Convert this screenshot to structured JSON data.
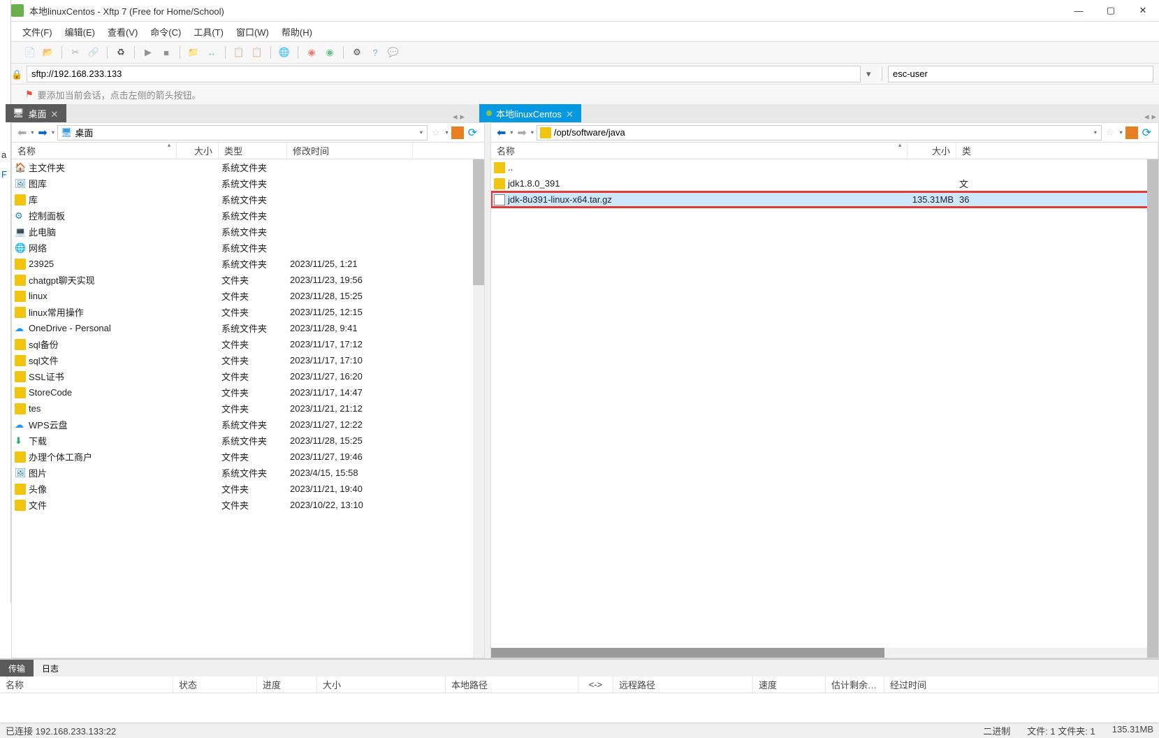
{
  "window": {
    "title": "本地linuxCentos - Xftp 7 (Free for Home/School)"
  },
  "menu": [
    "文件(F)",
    "编辑(E)",
    "查看(V)",
    "命令(C)",
    "工具(T)",
    "窗口(W)",
    "帮助(H)"
  ],
  "address": {
    "url": "sftp://192.168.233.133",
    "user": "esc-user"
  },
  "hint": "要添加当前会话，点击左侧的箭头按钮。",
  "tabs": {
    "local": "桌面",
    "remote": "本地linuxCentos"
  },
  "left_pane": {
    "path": "桌面",
    "cols": {
      "name": "名称",
      "size": "大小",
      "type": "类型",
      "modified": "修改时间"
    },
    "rows": [
      {
        "icon": "home",
        "name": "主文件夹",
        "type": "系统文件夹",
        "modified": ""
      },
      {
        "icon": "pic",
        "name": "图库",
        "type": "系统文件夹",
        "modified": ""
      },
      {
        "icon": "folder",
        "name": "库",
        "type": "系统文件夹",
        "modified": ""
      },
      {
        "icon": "panel",
        "name": "控制面板",
        "type": "系统文件夹",
        "modified": ""
      },
      {
        "icon": "pc",
        "name": "此电脑",
        "type": "系统文件夹",
        "modified": ""
      },
      {
        "icon": "net",
        "name": "网络",
        "type": "系统文件夹",
        "modified": ""
      },
      {
        "icon": "folder",
        "name": "23925",
        "type": "系统文件夹",
        "modified": "2023/11/25, 1:21"
      },
      {
        "icon": "folder",
        "name": "chatgpt聊天实现",
        "type": "文件夹",
        "modified": "2023/11/23, 19:56"
      },
      {
        "icon": "folder",
        "name": "linux",
        "type": "文件夹",
        "modified": "2023/11/28, 15:25"
      },
      {
        "icon": "folder",
        "name": "linux常用操作",
        "type": "文件夹",
        "modified": "2023/11/25, 12:15"
      },
      {
        "icon": "cloud",
        "name": "OneDrive - Personal",
        "type": "系统文件夹",
        "modified": "2023/11/28, 9:41"
      },
      {
        "icon": "folder",
        "name": "sql备份",
        "type": "文件夹",
        "modified": "2023/11/17, 17:12"
      },
      {
        "icon": "folder",
        "name": "sql文件",
        "type": "文件夹",
        "modified": "2023/11/17, 17:10"
      },
      {
        "icon": "folder",
        "name": "SSL证书",
        "type": "文件夹",
        "modified": "2023/11/27, 16:20"
      },
      {
        "icon": "folder",
        "name": "StoreCode",
        "type": "文件夹",
        "modified": "2023/11/17, 14:47"
      },
      {
        "icon": "folder",
        "name": "tes",
        "type": "文件夹",
        "modified": "2023/11/21, 21:12"
      },
      {
        "icon": "cloud",
        "name": "WPS云盘",
        "type": "系统文件夹",
        "modified": "2023/11/27, 12:22"
      },
      {
        "icon": "down",
        "name": "下载",
        "type": "系统文件夹",
        "modified": "2023/11/28, 15:25"
      },
      {
        "icon": "folder",
        "name": "办理个体工商户",
        "type": "文件夹",
        "modified": "2023/11/27, 19:46"
      },
      {
        "icon": "pic",
        "name": "图片",
        "type": "系统文件夹",
        "modified": "2023/4/15, 15:58"
      },
      {
        "icon": "folder",
        "name": "头像",
        "type": "文件夹",
        "modified": "2023/11/21, 19:40"
      },
      {
        "icon": "folder",
        "name": "文件",
        "type": "文件夹",
        "modified": "2023/10/22, 13:10"
      }
    ]
  },
  "right_pane": {
    "path": "/opt/software/java",
    "cols": {
      "name": "名称",
      "size": "大小",
      "type": "类"
    },
    "rows": [
      {
        "icon": "up",
        "name": "..",
        "size": "",
        "type": ""
      },
      {
        "icon": "folder",
        "name": "jdk1.8.0_391",
        "size": "",
        "type": "文"
      },
      {
        "icon": "file",
        "name": "jdk-8u391-linux-x64.tar.gz",
        "size": "135.31MB",
        "type": "36",
        "selected": true,
        "highlight": true
      }
    ]
  },
  "transfer": {
    "tabs": [
      "传输",
      "日志"
    ],
    "cols": [
      "名称",
      "状态",
      "进度",
      "大小",
      "本地路径",
      "<->",
      "远程路径",
      "速度",
      "估计剩余…",
      "经过时间"
    ]
  },
  "status": {
    "left": "已连接 192.168.233.133:22",
    "mode": "二进制",
    "files": "文件: 1 文件夹: 1",
    "size": "135.31MB"
  },
  "sliver": {
    "a": "a",
    "f": "F"
  }
}
